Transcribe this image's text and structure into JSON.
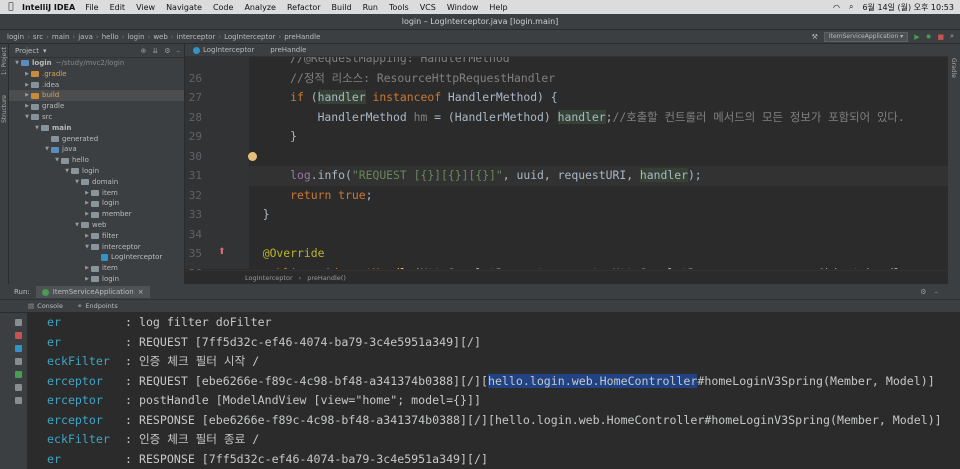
{
  "mac_menu": {
    "app_name": "IntelliJ IDEA",
    "items": [
      "File",
      "Edit",
      "View",
      "Navigate",
      "Code",
      "Analyze",
      "Refactor",
      "Build",
      "Run",
      "Tools",
      "VCS",
      "Window",
      "Help"
    ],
    "datetime": "6월 14일 (월) 오후 10:53"
  },
  "window_title": "login – LogInterceptor.java [login.main]",
  "breadcrumb": [
    "login",
    "src",
    "main",
    "java",
    "hello",
    "login",
    "web",
    "interceptor",
    "LogInterceptor",
    "preHandle"
  ],
  "run_configuration": "ItemServiceApplication",
  "left_strip": {
    "project_label": "1: Project",
    "structure_label": "Structure"
  },
  "right_strip_label": "Gradle",
  "project_panel": {
    "title": "Project",
    "tree": [
      {
        "label": "login",
        "extra": "~/study/mvc2/login",
        "depth": 0,
        "open": true,
        "kind": "folder-blue",
        "bold": true
      },
      {
        "label": ".gradle",
        "depth": 1,
        "open": false,
        "kind": "folder-orange",
        "orange": true
      },
      {
        "label": ".idea",
        "depth": 1,
        "open": false,
        "kind": "folder"
      },
      {
        "label": "build",
        "depth": 1,
        "open": false,
        "kind": "folder-orange",
        "orange": true,
        "selected": true
      },
      {
        "label": "gradle",
        "depth": 1,
        "open": false,
        "kind": "folder"
      },
      {
        "label": "src",
        "depth": 1,
        "open": true,
        "kind": "folder"
      },
      {
        "label": "main",
        "depth": 2,
        "open": true,
        "kind": "folder",
        "bold": true
      },
      {
        "label": "generated",
        "depth": 3,
        "open": null,
        "kind": "folder"
      },
      {
        "label": "java",
        "depth": 3,
        "open": true,
        "kind": "folder-blue"
      },
      {
        "label": "hello",
        "depth": 4,
        "open": true,
        "kind": "pkg"
      },
      {
        "label": "login",
        "depth": 5,
        "open": true,
        "kind": "pkg"
      },
      {
        "label": "domain",
        "depth": 6,
        "open": true,
        "kind": "pkg"
      },
      {
        "label": "item",
        "depth": 7,
        "open": false,
        "kind": "pkg"
      },
      {
        "label": "login",
        "depth": 7,
        "open": false,
        "kind": "pkg"
      },
      {
        "label": "member",
        "depth": 7,
        "open": false,
        "kind": "pkg"
      },
      {
        "label": "web",
        "depth": 6,
        "open": true,
        "kind": "pkg"
      },
      {
        "label": "filter",
        "depth": 7,
        "open": false,
        "kind": "pkg"
      },
      {
        "label": "interceptor",
        "depth": 7,
        "open": true,
        "kind": "pkg"
      },
      {
        "label": "LogInterceptor",
        "depth": 8,
        "open": null,
        "kind": "class"
      },
      {
        "label": "item",
        "depth": 7,
        "open": false,
        "kind": "pkg"
      },
      {
        "label": "login",
        "depth": 7,
        "open": false,
        "kind": "pkg"
      }
    ]
  },
  "editor": {
    "tab_label": "LogInterceptor",
    "tab2_label": "preHandle",
    "lines": [
      {
        "n": "",
        "html": "<span class=\"cm\">    //@RequestMapping: HandlerMethod</span>"
      },
      {
        "n": "26",
        "html": "<span class=\"cm\">    //정적 리소스: ResourceHttpRequestHandler</span>"
      },
      {
        "n": "27",
        "html": "    <span class=\"kw\">if</span> (<span class=\"hl\">handler</span> <span class=\"kw\">instanceof</span> HandlerMethod) {"
      },
      {
        "n": "28",
        "html": "        HandlerMethod <span class=\"cm\">hm</span> = (HandlerMethod) <span class=\"hl\">handler</span>;<span class=\"cm\">//호출할 컨트롤러 메서드의 모든 정보가 포함되어 있다.</span>"
      },
      {
        "n": "29",
        "html": "    }"
      },
      {
        "n": "30",
        "html": ""
      },
      {
        "n": "31",
        "html": "    <span class=\"fld\">log</span>.info(<span class=\"st\">\"REQUEST [{}][{}][{}]\"</span>, uuid, requestURI, <span class=\"hl\">handler</span>);",
        "current": true
      },
      {
        "n": "32",
        "html": "    <span class=\"kw\">return true</span>;"
      },
      {
        "n": "33",
        "html": "}"
      },
      {
        "n": "34",
        "html": ""
      },
      {
        "n": "35",
        "html": "<span class=\"an\">@Override</span>"
      },
      {
        "n": "36",
        "html": "<span class=\"kw\">public void</span> <span class=\"fn\">postHandle</span>(HttpServletRequest request, HttpServletResponse response, Object handler,"
      }
    ],
    "footer_crumbs": [
      "LogInterceptor",
      "preHandle()"
    ]
  },
  "run_panel": {
    "label": "Run:",
    "tab": "ItemServiceApplication",
    "sub_tabs": [
      "Console",
      "Endpoints"
    ],
    "lines": [
      {
        "src": "er",
        "msg": ": log filter doFilter"
      },
      {
        "src": "er",
        "msg": ": REQUEST [7ff5d32c-ef46-4074-ba79-3c4e5951a349][/]"
      },
      {
        "src": "eckFilter",
        "msg": ": 인증 체크 필터 시작 /"
      },
      {
        "src": "erceptor",
        "msg": ": REQUEST [ebe6266e-f89c-4c98-bf48-a341374b0388][/][",
        "sel": "hello.login.web.HomeController",
        "tail": "#homeLoginV3Spring(Member, Model)]"
      },
      {
        "src": "erceptor",
        "msg": ": postHandle [ModelAndView [view=\"home\"; model={}]]"
      },
      {
        "src": "erceptor",
        "msg": ": RESPONSE [ebe6266e-f89c-4c98-bf48-a341374b0388][/][hello.login.web.HomeController#homeLoginV3Spring(Member, Model)]"
      },
      {
        "src": "eckFilter",
        "msg": ": 인증 체크 필터 종료 /"
      },
      {
        "src": "er",
        "msg": ": RESPONSE [7ff5d32c-ef46-4074-ba79-3c4e5951a349][/]"
      }
    ]
  }
}
